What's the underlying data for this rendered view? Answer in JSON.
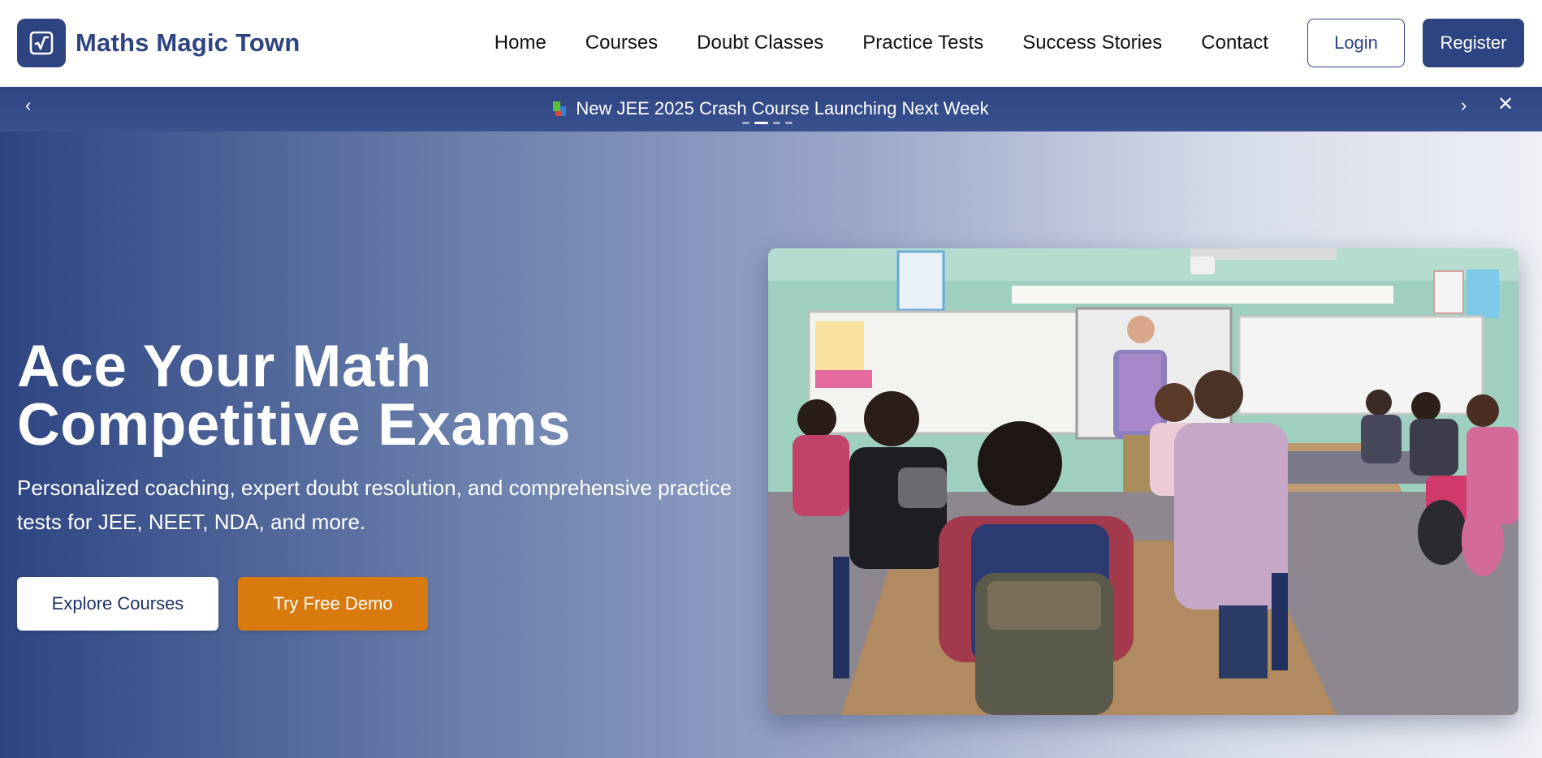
{
  "header": {
    "brand_name": "Maths Magic Town",
    "logo_icon": "square-root-icon",
    "nav": [
      "Home",
      "Courses",
      "Doubt Classes",
      "Practice Tests",
      "Success Stories",
      "Contact"
    ],
    "login_label": "Login",
    "register_label": "Register"
  },
  "announcement": {
    "text": "New JEE 2025 Crash Course Launching Next Week",
    "icon": "books-icon",
    "slide_count": 4,
    "active_slide": 2,
    "prev_icon": "chevron-left-icon",
    "next_icon": "chevron-right-icon",
    "close_icon": "close-icon"
  },
  "hero": {
    "headline_line1": "Ace Your Math",
    "headline_line2": "Competitive Exams",
    "subheadline": "Personalized coaching, expert doubt resolution, and comprehensive practice tests for JEE, NEET, NDA, and more.",
    "explore_label": "Explore Courses",
    "demo_label": "Try Free Demo"
  },
  "colors": {
    "brand": "#2e4482",
    "accent": "#d97a0f",
    "white": "#ffffff"
  }
}
